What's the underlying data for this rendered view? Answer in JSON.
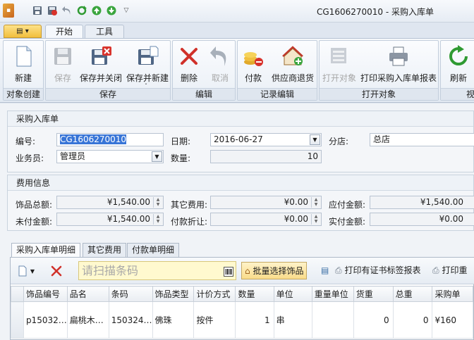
{
  "window": {
    "title": "CG1606270010 - 采购入库单"
  },
  "ribbon_tabs": [
    {
      "label": "开始"
    },
    {
      "label": "工具"
    }
  ],
  "ribbon": {
    "groups": {
      "create": "对象创建",
      "save": "保存",
      "edit": "编辑",
      "record": "记录编辑",
      "open": "打开对象",
      "view": "视"
    },
    "buttons": {
      "new": "新建",
      "save": "保存",
      "save_close": "保存并关闭",
      "save_new": "保存并新建",
      "delete": "删除",
      "undo": "取消",
      "pay": "付款",
      "return_supplier": "供应商退货",
      "open_object": "打开对象",
      "print_report": "打印采购入库单报表",
      "refresh": "刷新"
    }
  },
  "form": {
    "section_title": "采购入库单",
    "labels": {
      "code": "编号:",
      "date": "日期:",
      "branch": "分店:",
      "clerk": "业务员:",
      "qty": "数量:"
    },
    "values": {
      "code": "CG1606270010",
      "date": "2016-06-27",
      "branch": "总店",
      "clerk": "管理员",
      "qty": "10"
    }
  },
  "fees": {
    "section_title": "费用信息",
    "labels": {
      "total": "饰品总额:",
      "other": "其它费用:",
      "payable": "应付金额:",
      "unpaid": "未付金额:",
      "discount": "付款折让:",
      "actual": "实付金额:"
    },
    "values": {
      "total": "¥1,540.00",
      "other": "¥0.00",
      "payable": "¥1,540.00",
      "unpaid": "¥1,540.00",
      "discount": "¥0.00",
      "actual": "¥0.00"
    }
  },
  "detail_tabs": [
    {
      "label": "采购入库单明细"
    },
    {
      "label": "其它费用"
    },
    {
      "label": "付款单明细"
    }
  ],
  "detail_toolbar": {
    "scan_placeholder": "请扫描条码",
    "batch_select": "批量选择饰品",
    "print_cert_label": "打印有证书标签报表",
    "print_weight": "打印重"
  },
  "grid": {
    "columns": [
      "饰品编号",
      "品名",
      "条码",
      "饰品类型",
      "计价方式",
      "数量",
      "单位",
      "重量单位",
      "货重",
      "总重",
      "采购单"
    ],
    "rows": [
      [
        "p15032…",
        "扁桃木…",
        "150324…",
        "佛珠",
        "按件",
        "1",
        "串",
        "",
        "0",
        "0",
        "¥160"
      ]
    ]
  },
  "colors": {
    "accent": "#3875d7",
    "ribbon_bg": "#e2e9f2",
    "scan_bg": "#fff9cf"
  }
}
